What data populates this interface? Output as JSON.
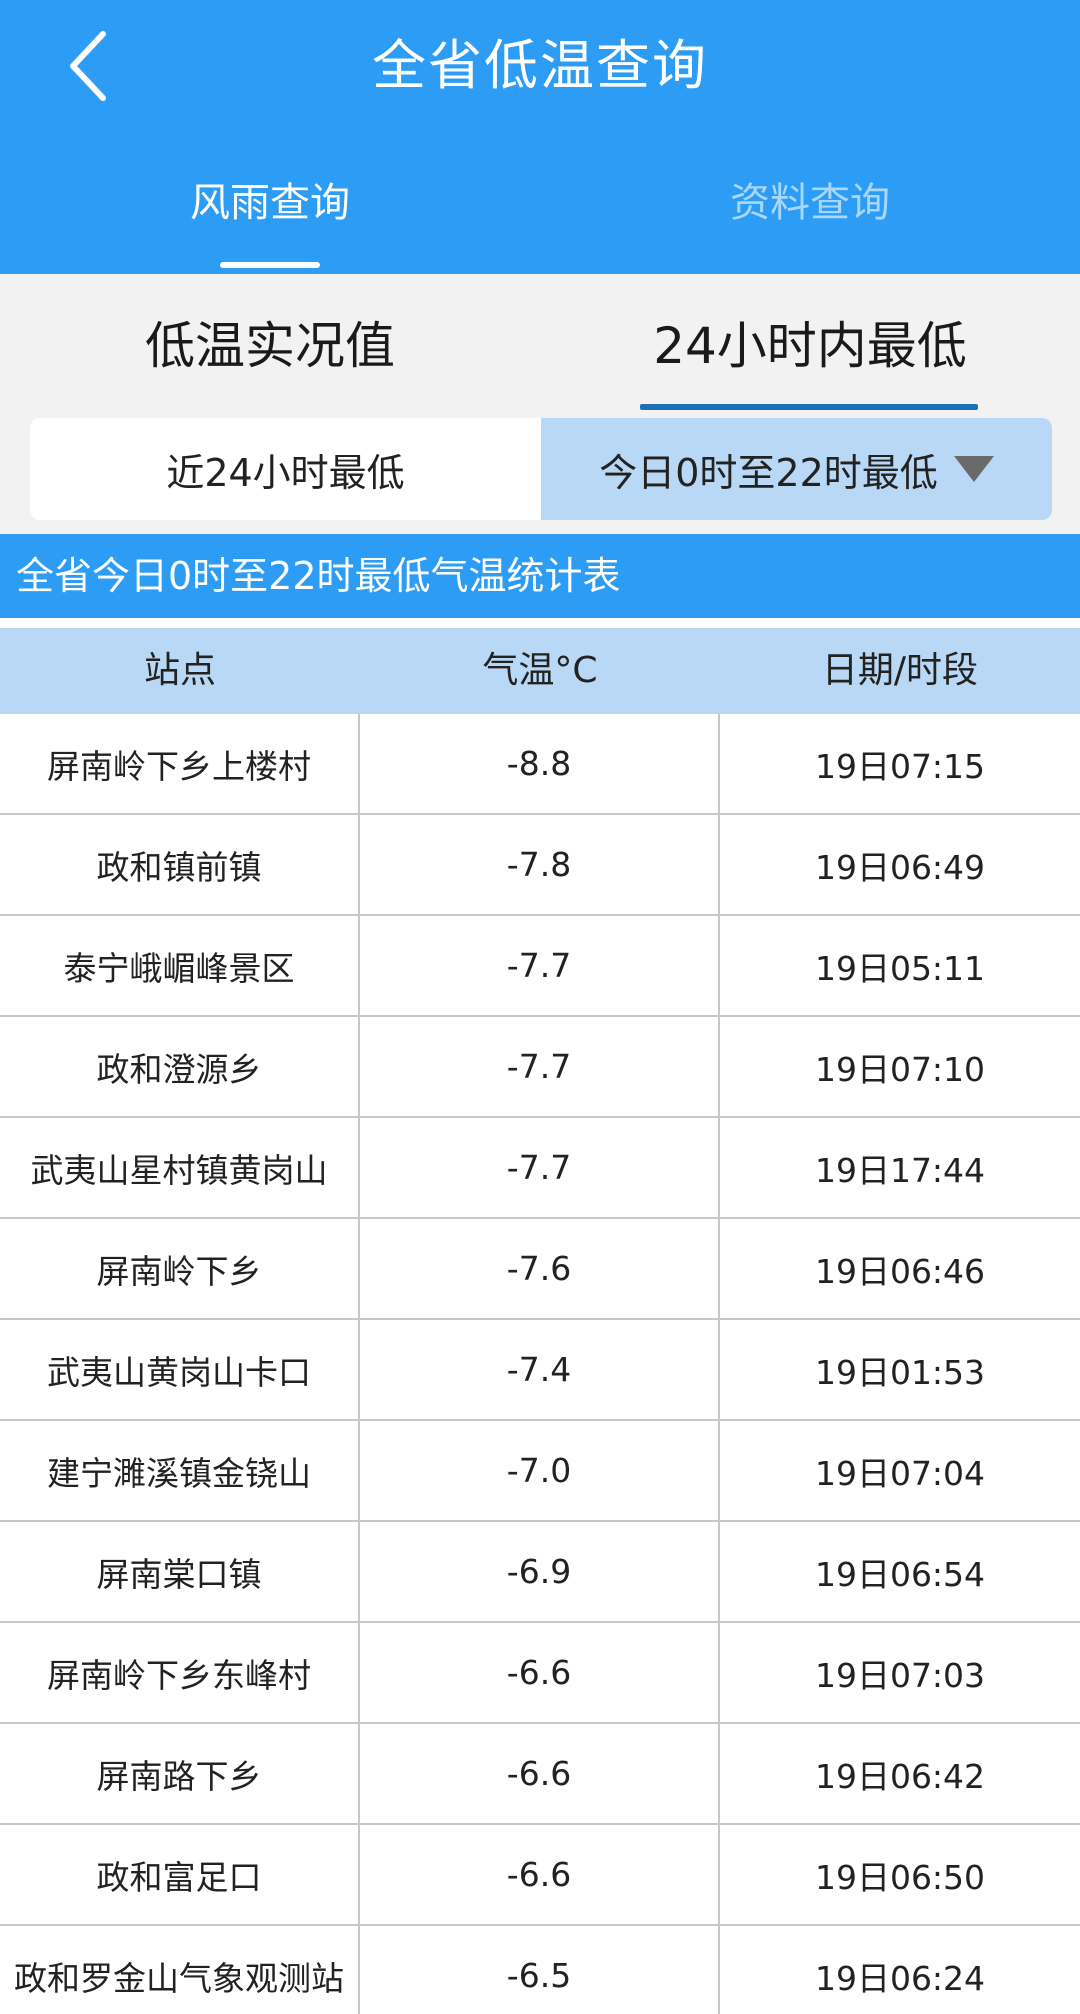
{
  "header": {
    "title": "全省低温查询",
    "tabs": [
      "风雨查询",
      "资料查询"
    ]
  },
  "sub_tabs": [
    "低温实况值",
    "24小时内最低"
  ],
  "segments": [
    "近24小时最低",
    "今日0时至22时最低"
  ],
  "table": {
    "title": "全省今日0时至22时最低气温统计表",
    "headers": [
      "站点",
      "气温°C",
      "日期/时段"
    ],
    "rows": [
      {
        "station": "屏南岭下乡上楼村",
        "temp": "-8.8",
        "time": "19日07:15"
      },
      {
        "station": "政和镇前镇",
        "temp": "-7.8",
        "time": "19日06:49"
      },
      {
        "station": "泰宁峨嵋峰景区",
        "temp": "-7.7",
        "time": "19日05:11"
      },
      {
        "station": "政和澄源乡",
        "temp": "-7.7",
        "time": "19日07:10"
      },
      {
        "station": "武夷山星村镇黄岗山",
        "temp": "-7.7",
        "time": "19日17:44"
      },
      {
        "station": "屏南岭下乡",
        "temp": "-7.6",
        "time": "19日06:46"
      },
      {
        "station": "武夷山黄岗山卡口",
        "temp": "-7.4",
        "time": "19日01:53"
      },
      {
        "station": "建宁濉溪镇金铙山",
        "temp": "-7.0",
        "time": "19日07:04"
      },
      {
        "station": "屏南棠口镇",
        "temp": "-6.9",
        "time": "19日06:54"
      },
      {
        "station": "屏南岭下乡东峰村",
        "temp": "-6.6",
        "time": "19日07:03"
      },
      {
        "station": "屏南路下乡",
        "temp": "-6.6",
        "time": "19日06:42"
      },
      {
        "station": "政和富足口",
        "temp": "-6.6",
        "time": "19日06:50"
      },
      {
        "station": "政和罗金山气象观测站",
        "temp": "-6.5",
        "time": "19日06:24"
      }
    ]
  },
  "colors": {
    "header_bg": "#2d9cf5",
    "segment_active_bg": "#b9d8f5",
    "underline": "#1f6fb8"
  },
  "icons": {
    "back": "chevron-left-icon",
    "dropdown": "triangle-down-icon"
  }
}
